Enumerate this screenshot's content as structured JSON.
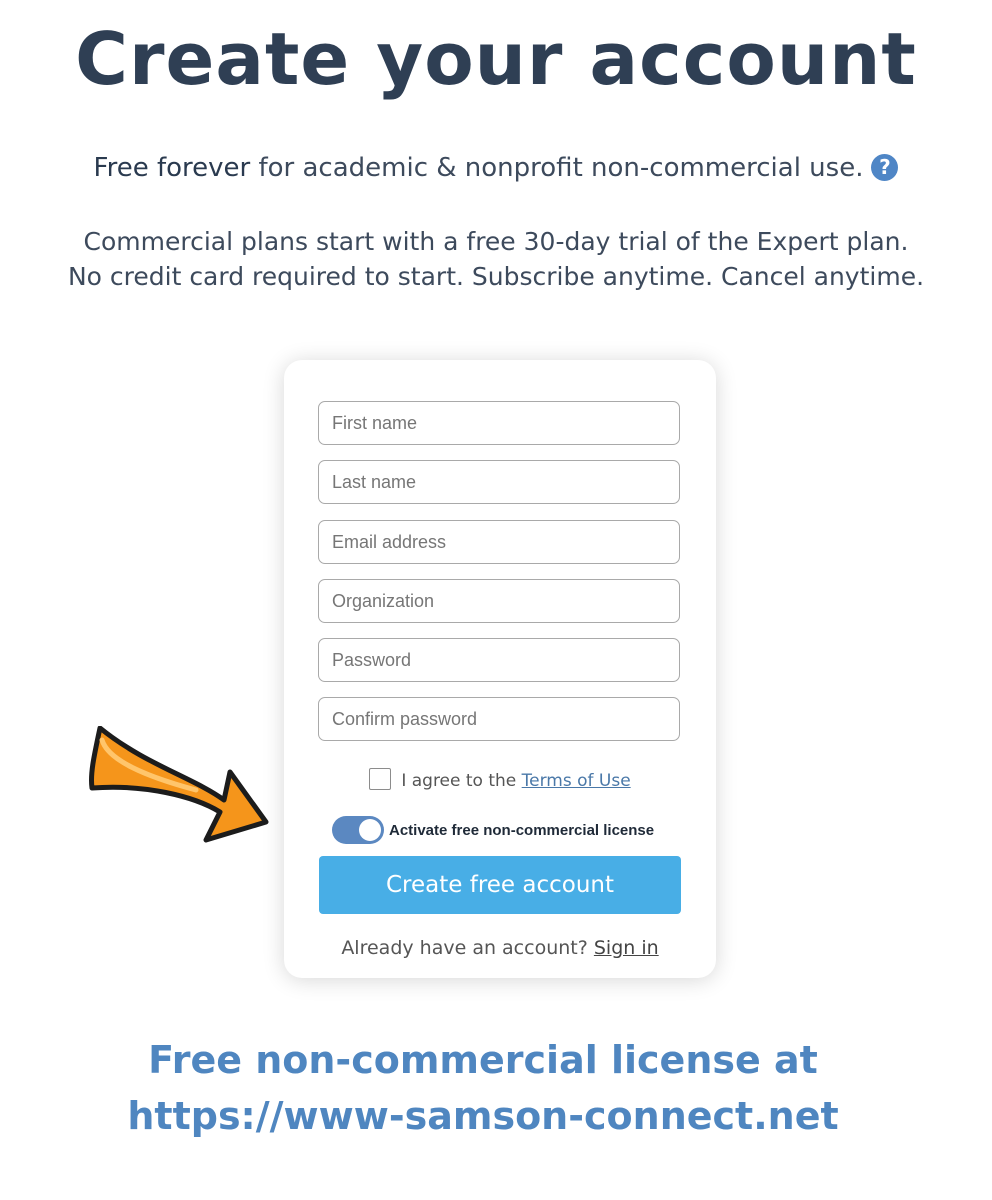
{
  "header": {
    "title": "Create your account",
    "tagline_strong": "Free forever",
    "tagline_rest": " for academic & nonprofit non-commercial use.",
    "help_icon": "question-circle-icon",
    "commercial_line1": "Commercial plans start with a free 30-day trial of the Expert plan.",
    "commercial_line2": "No credit card required to start. Subscribe anytime. Cancel anytime."
  },
  "form": {
    "first_name_placeholder": "First name",
    "last_name_placeholder": "Last name",
    "email_placeholder": "Email address",
    "organization_placeholder": "Organization",
    "password_placeholder": "Password",
    "confirm_password_placeholder": "Confirm password",
    "agree_text": "I agree to the ",
    "terms_link": "Terms of Use",
    "agree_checked": false,
    "toggle_label": "Activate free non-commercial license",
    "toggle_on": true,
    "submit_label": "Create free account",
    "signin_prompt": "Already have an account? ",
    "signin_link": "Sign in"
  },
  "annotation": {
    "arrow_icon": "orange-arrow-icon",
    "footer_line1": "Free non-commercial license at",
    "footer_line2": "https://www-samson-connect.net"
  },
  "colors": {
    "title": "#2f3f54",
    "button": "#48aee6",
    "toggle": "#5b88c1",
    "footer_text": "#4f86c0",
    "arrow": "#f5951b"
  }
}
